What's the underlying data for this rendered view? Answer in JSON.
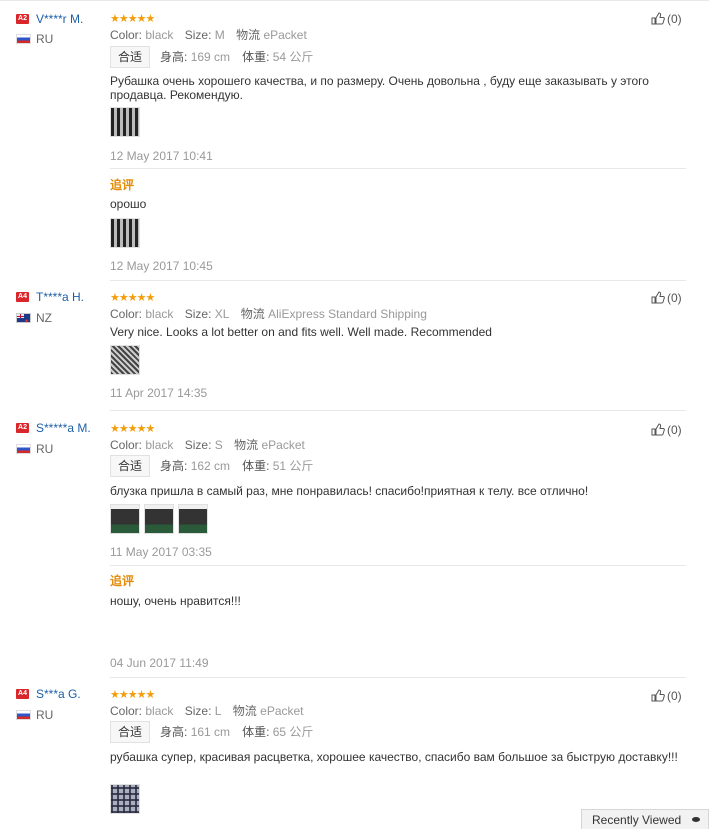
{
  "labels": {
    "color": "Color:",
    "size": "Size:",
    "logistics": "物流",
    "fit": "合适",
    "height": "身高:",
    "weight": "体重:",
    "additional": "追评"
  },
  "reviews": [
    {
      "level": "A2",
      "name": "V****r M.",
      "country": "RU",
      "stars": "★★★★★",
      "color": "black",
      "size": "M",
      "shipping": "ePacket",
      "height": "169 cm",
      "weight": "54 公斤",
      "text": "Рубашка очень хорошего качества, и по размеру. Очень довольна , буду еще заказывать у этого продавца. Рекомендую.",
      "date": "12 May 2017 10:41",
      "followup_text": "орошо",
      "followup_date": "12 May 2017 10:45",
      "likes": "(0)"
    },
    {
      "level": "A4",
      "name": "T****a H.",
      "country": "NZ",
      "stars": "★★★★★",
      "color": "black",
      "size": "XL",
      "shipping": "AliExpress Standard Shipping",
      "text": "Very nice. Looks a lot better on and fits well. Well made. Recommended",
      "date": "11 Apr 2017 14:35",
      "likes": "(0)"
    },
    {
      "level": "A2",
      "name": "S*****a M.",
      "country": "RU",
      "stars": "★★★★★",
      "color": "black",
      "size": "S",
      "shipping": "ePacket",
      "height": "162 cm",
      "weight": "51 公斤",
      "text": "блузка пришла в самый раз, мне понравилась! спасибо!приятная к телу. все отлично!",
      "date": "11 May 2017 03:35",
      "followup_text": "ношу, очень нравится!!!",
      "followup_date": "04 Jun 2017 11:49",
      "likes": "(0)"
    },
    {
      "level": "A4",
      "name": "S***a G.",
      "country": "RU",
      "stars": "★★★★★",
      "color": "black",
      "size": "L",
      "shipping": "ePacket",
      "height": "161 cm",
      "weight": "65 公斤",
      "text": "рубашка супер, красивая расцветка, хорошее качество, спасибо вам большое за быструю доставку!!!",
      "likes": "(0)"
    }
  ],
  "recently_viewed": "Recently Viewed",
  "colors": {
    "accent_star": "#f29d0a",
    "name_link": "#1d5fa6",
    "level_badge": "#d9262b",
    "followup_label": "#e38c0a"
  }
}
